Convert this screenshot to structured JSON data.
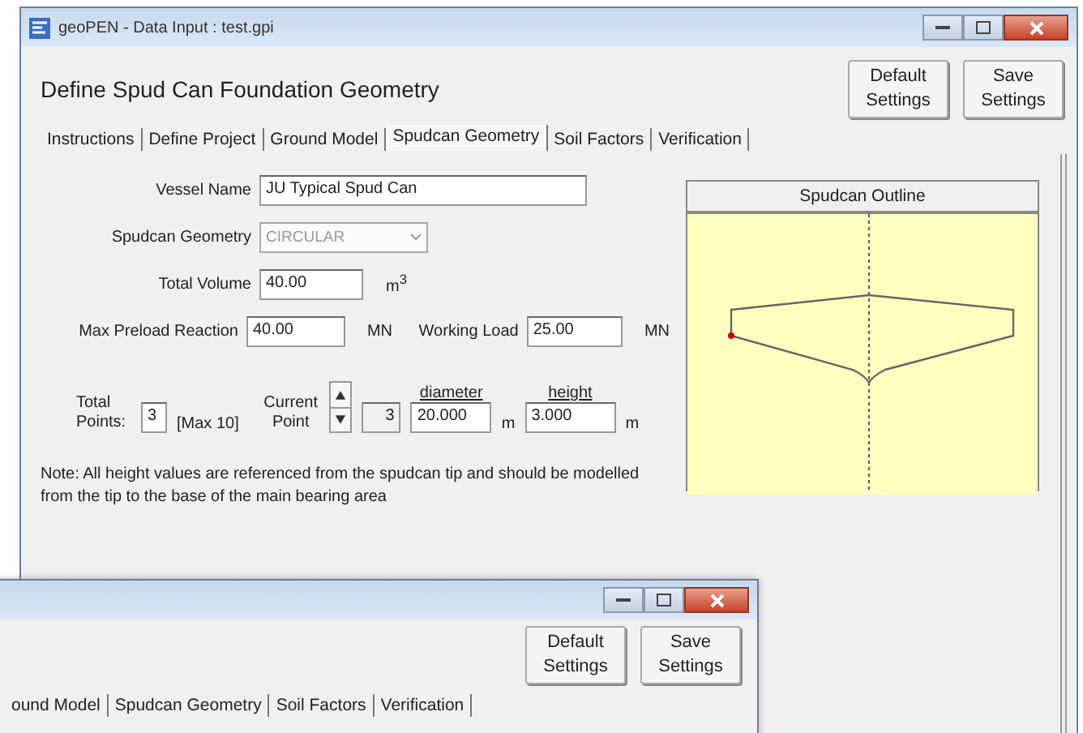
{
  "window": {
    "title": "geoPEN - Data Input : test.gpi"
  },
  "heading": "Define Spud Can Foundation Geometry",
  "buttons": [
    "Default Settings",
    "Save Settings"
  ],
  "tabs": [
    {
      "label": "Instructions",
      "selected": false
    },
    {
      "label": "Define Project",
      "selected": false
    },
    {
      "label": "Ground Model",
      "selected": false
    },
    {
      "label": "Spudcan Geometry",
      "selected": true
    },
    {
      "label": "Soil Factors",
      "selected": false
    },
    {
      "label": "Verification",
      "selected": false
    }
  ],
  "form": {
    "vessel_name": {
      "label": "Vessel Name",
      "value": "JU Typical Spud Can"
    },
    "spudcan_geometry": {
      "label": "Spudcan Geometry",
      "value": "CIRCULAR",
      "disabled": true
    },
    "total_volume": {
      "label": "Total Volume",
      "value": "40.00",
      "unit": "m$^{3}$"
    },
    "max_preload": {
      "label": "Max Preload Reaction",
      "value": "40.00",
      "unit": "MN"
    },
    "working_load": {
      "label": "Working Load",
      "value": "25.00",
      "unit": "MN"
    }
  },
  "points": {
    "total_label": "Total Points:",
    "total_value": "3",
    "max": "[Max 10]",
    "current_label": "Current Point",
    "current_value": "3",
    "diameter_label": "diameter",
    "diameter_value": "20.000",
    "diameter_unit": "m",
    "height_label": "height",
    "height_value": "3.000",
    "height_unit": "m"
  },
  "note": "Note: All height values are referenced from the spudcan tip and should be modelled from the tip to the base of the main bearing area",
  "outline": {
    "title": "Spudcan Outline"
  },
  "second_window": {
    "buttons": [
      "Default Settings",
      "Save Settings"
    ],
    "tabs": [
      {
        "label": "ound Model",
        "selected": false
      },
      {
        "label": "Spudcan Geometry",
        "selected": false
      },
      {
        "label": "Soil Factors",
        "selected": false
      },
      {
        "label": "Verification",
        "selected": false
      }
    ]
  }
}
